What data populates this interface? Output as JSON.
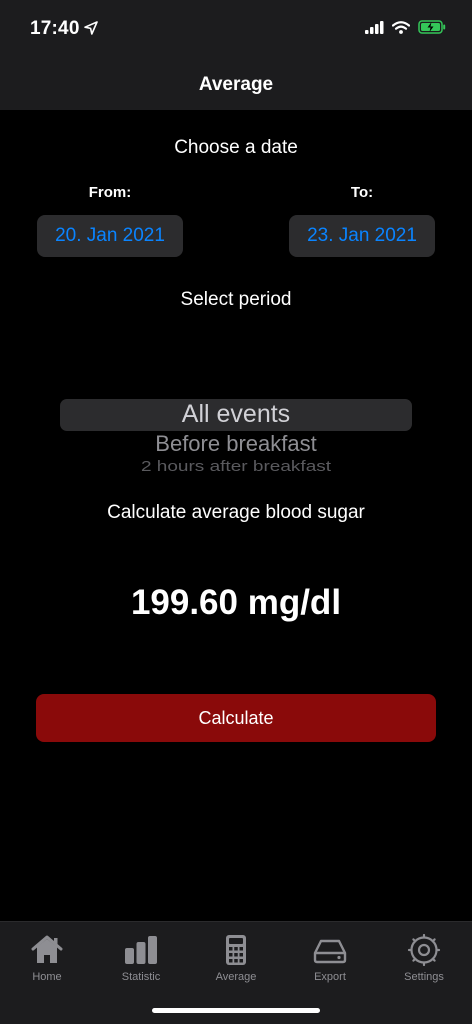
{
  "status_bar": {
    "time": "17:40"
  },
  "nav": {
    "title": "Average"
  },
  "date_section": {
    "heading": "Choose a date",
    "from_label": "From:",
    "to_label": "To:",
    "from_value": "20. Jan 2021",
    "to_value": "23. Jan 2021"
  },
  "period_section": {
    "heading": "Select period",
    "options": [
      "All events",
      "Before breakfast",
      "2 hours after breakfast"
    ],
    "selected": "All events"
  },
  "calc_section": {
    "heading": "Calculate average blood sugar",
    "result": "199.60 mg/dl",
    "button_label": "Calculate"
  },
  "tab_bar": {
    "items": [
      {
        "label": "Home",
        "icon": "home-icon"
      },
      {
        "label": "Statistic",
        "icon": "bar-chart-icon"
      },
      {
        "label": "Average",
        "icon": "calculator-icon"
      },
      {
        "label": "Export",
        "icon": "drive-icon"
      },
      {
        "label": "Settings",
        "icon": "gear-icon"
      }
    ]
  },
  "colors": {
    "accent": "#0a84ff",
    "button": "#8a0a0a",
    "background": "#000000",
    "battery": "#34c759"
  }
}
